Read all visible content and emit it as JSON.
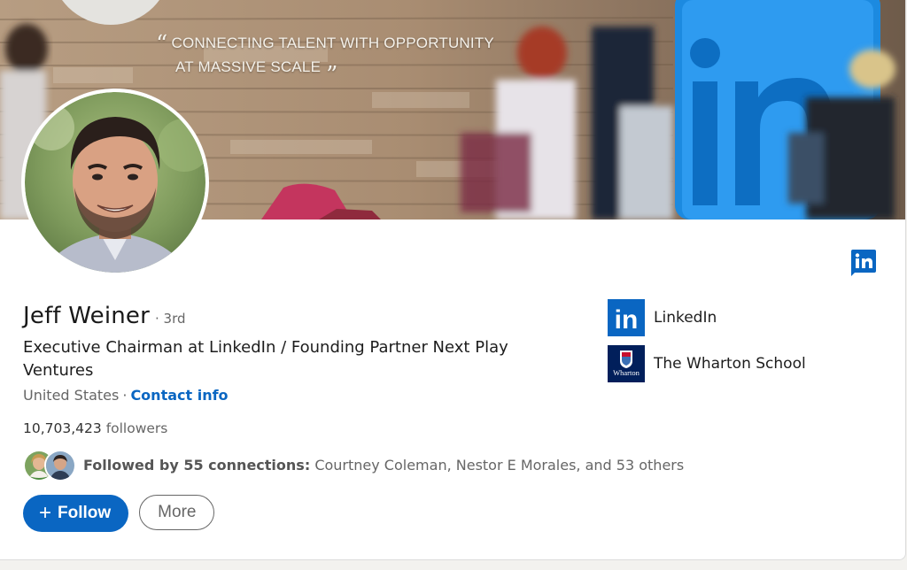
{
  "banner": {
    "quote_line1": "CONNECTING TALENT WITH OPPORTUNITY",
    "quote_line2": "AT MASSIVE SCALE",
    "open_quote": "“",
    "close_quote": "”"
  },
  "profile": {
    "name": "Jeff Weiner",
    "degree": "· 3rd",
    "headline": "Executive Chairman at LinkedIn / Founding Partner Next Play Ventures",
    "location": "United States",
    "separator": "·",
    "contact_label": "Contact info",
    "followers_count": "10,703,423",
    "followers_label": "followers"
  },
  "connections": {
    "followed_by": "Followed by 55 connections:",
    "names": "Courtney Coleman, Nestor E Morales, and 53 others"
  },
  "actions": {
    "follow_plus": "+",
    "follow_label": "Follow",
    "more_label": "More"
  },
  "experience": [
    {
      "name": "LinkedIn",
      "logo": "linkedin-logo"
    },
    {
      "name": "The Wharton School",
      "logo": "wharton-logo"
    }
  ],
  "logo_text": {
    "linkedin": "in",
    "wharton": "Wharton"
  },
  "colors": {
    "accent": "#0a66c2",
    "wharton_navy": "#011f5b"
  }
}
